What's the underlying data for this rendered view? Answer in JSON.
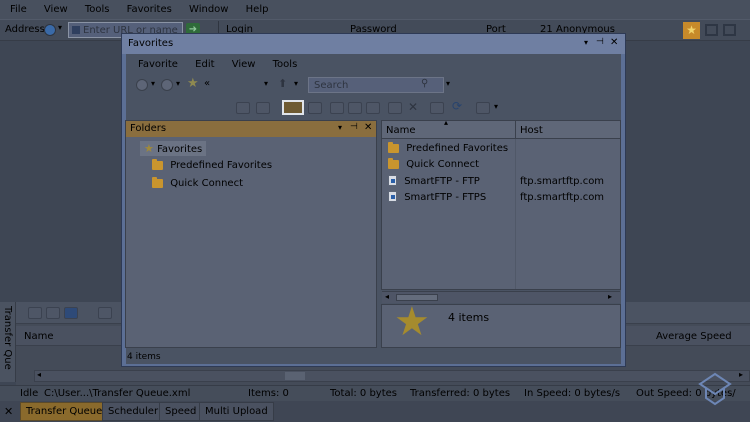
{
  "menubar": {
    "items": [
      "File",
      "View",
      "Tools",
      "Favorites",
      "Window",
      "Help"
    ]
  },
  "addressbar": {
    "address_label": "Address",
    "url_placeholder": "Enter URL or name",
    "login_label": "Login",
    "password_label": "Password",
    "port_label": "Port",
    "port_value": "21",
    "anonymous_label": "Anonymous"
  },
  "favorites_window": {
    "title": "Favorites",
    "menu": [
      "Favorite",
      "Edit",
      "View",
      "Tools"
    ],
    "search_placeholder": "Search",
    "nav_extra": "«",
    "folders_panel": {
      "title": "Folders",
      "tree": [
        {
          "label": "Favorites",
          "level": 0
        },
        {
          "label": "Predefined Favorites",
          "level": 1
        },
        {
          "label": "Quick Connect",
          "level": 1
        }
      ],
      "status": "4 items"
    },
    "list": {
      "columns": [
        "Name",
        "Host"
      ],
      "rows": [
        {
          "name": "Predefined Favorites",
          "host": "",
          "icon": "folder"
        },
        {
          "name": "Quick Connect",
          "host": "",
          "icon": "folder"
        },
        {
          "name": "SmartFTP - FTP",
          "host": "ftp.smartftp.com",
          "icon": "site"
        },
        {
          "name": "SmartFTP - FTPS",
          "host": "ftp.smartftp.com",
          "icon": "site"
        }
      ],
      "details_count": "4 items"
    }
  },
  "transfer_queue": {
    "side_label": "Transfer Que",
    "columns": [
      "Name",
      "Average Speed"
    ]
  },
  "statusbar": {
    "idle": "Idle",
    "file": "C:\\User...\\Transfer Queue.xml",
    "items": "Items: 0",
    "total": "Total: 0 bytes",
    "transferred": "Transferred: 0 bytes",
    "in_speed": "In Speed: 0 bytes/s",
    "out_speed": "Out Speed: 0 bytes/"
  },
  "bottom_tabs": [
    "Transfer Queue",
    "Scheduler",
    "Speed",
    "Multi Upload"
  ],
  "colors": {
    "accent": "#c9952e",
    "dim_overlay": "#3e4654",
    "window_frame": "#5c6f95"
  }
}
